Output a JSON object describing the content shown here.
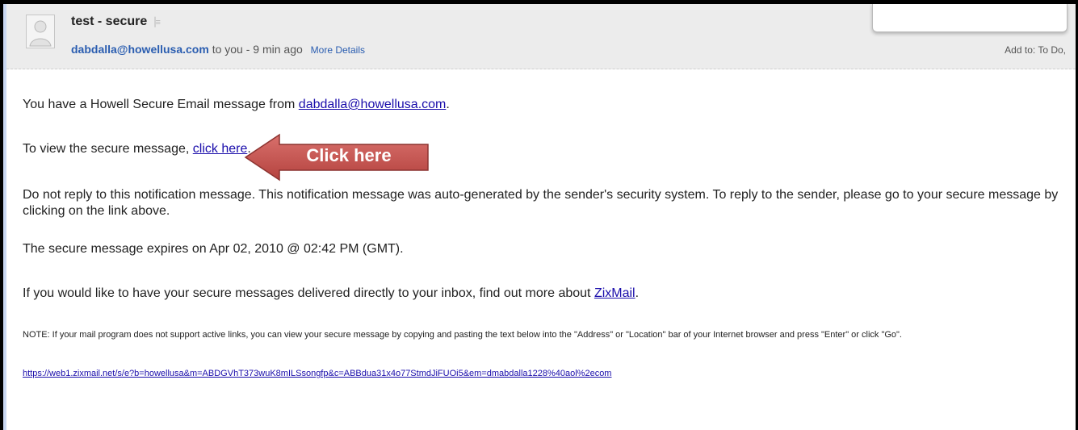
{
  "email": {
    "subject": "test - secure",
    "star_icon": "flag-icon",
    "sender": "dabdalla@howellusa.com",
    "meta_suffix": " to you - 9 min ago",
    "more_details": "More Details",
    "add_to": "Add to: To Do,"
  },
  "body": {
    "p1_text": "You have a Howell Secure Email message from ",
    "p1_link": "dabdalla@howellusa.com",
    "p1_end": ".",
    "p2_text": "To view the secure message, ",
    "p2_link": "click here",
    "p2_end": ".",
    "p3_text": "Do not reply to this notification message. This notification message was auto-generated by the sender's security system. To reply to the sender, please go to your secure message by clicking on the link above.",
    "p4_text": "The secure message expires on Apr 02, 2010 @ 02:42 PM (GMT).",
    "p5_text": "If you would like to have your secure messages delivered directly to your inbox, find out more about ",
    "p5_link": "ZixMail",
    "p5_end": ".",
    "p6_text": "NOTE: If your mail program does not support active links, you can view your secure message by copying and pasting the text below into the \"Address\" or \"Location\" bar of your Internet browser and press \"Enter\" or click \"Go\".",
    "p7_link": "https://web1.zixmail.net/s/e?b=howellusa&m=ABDGVhT373wuK8mILSsongfp&c=ABBdua31x4o77StmdJiFUOi5&em=dmabdalla1228%40aol%2ecom"
  },
  "callout": {
    "label": "Click here",
    "color": "#c0504d"
  }
}
